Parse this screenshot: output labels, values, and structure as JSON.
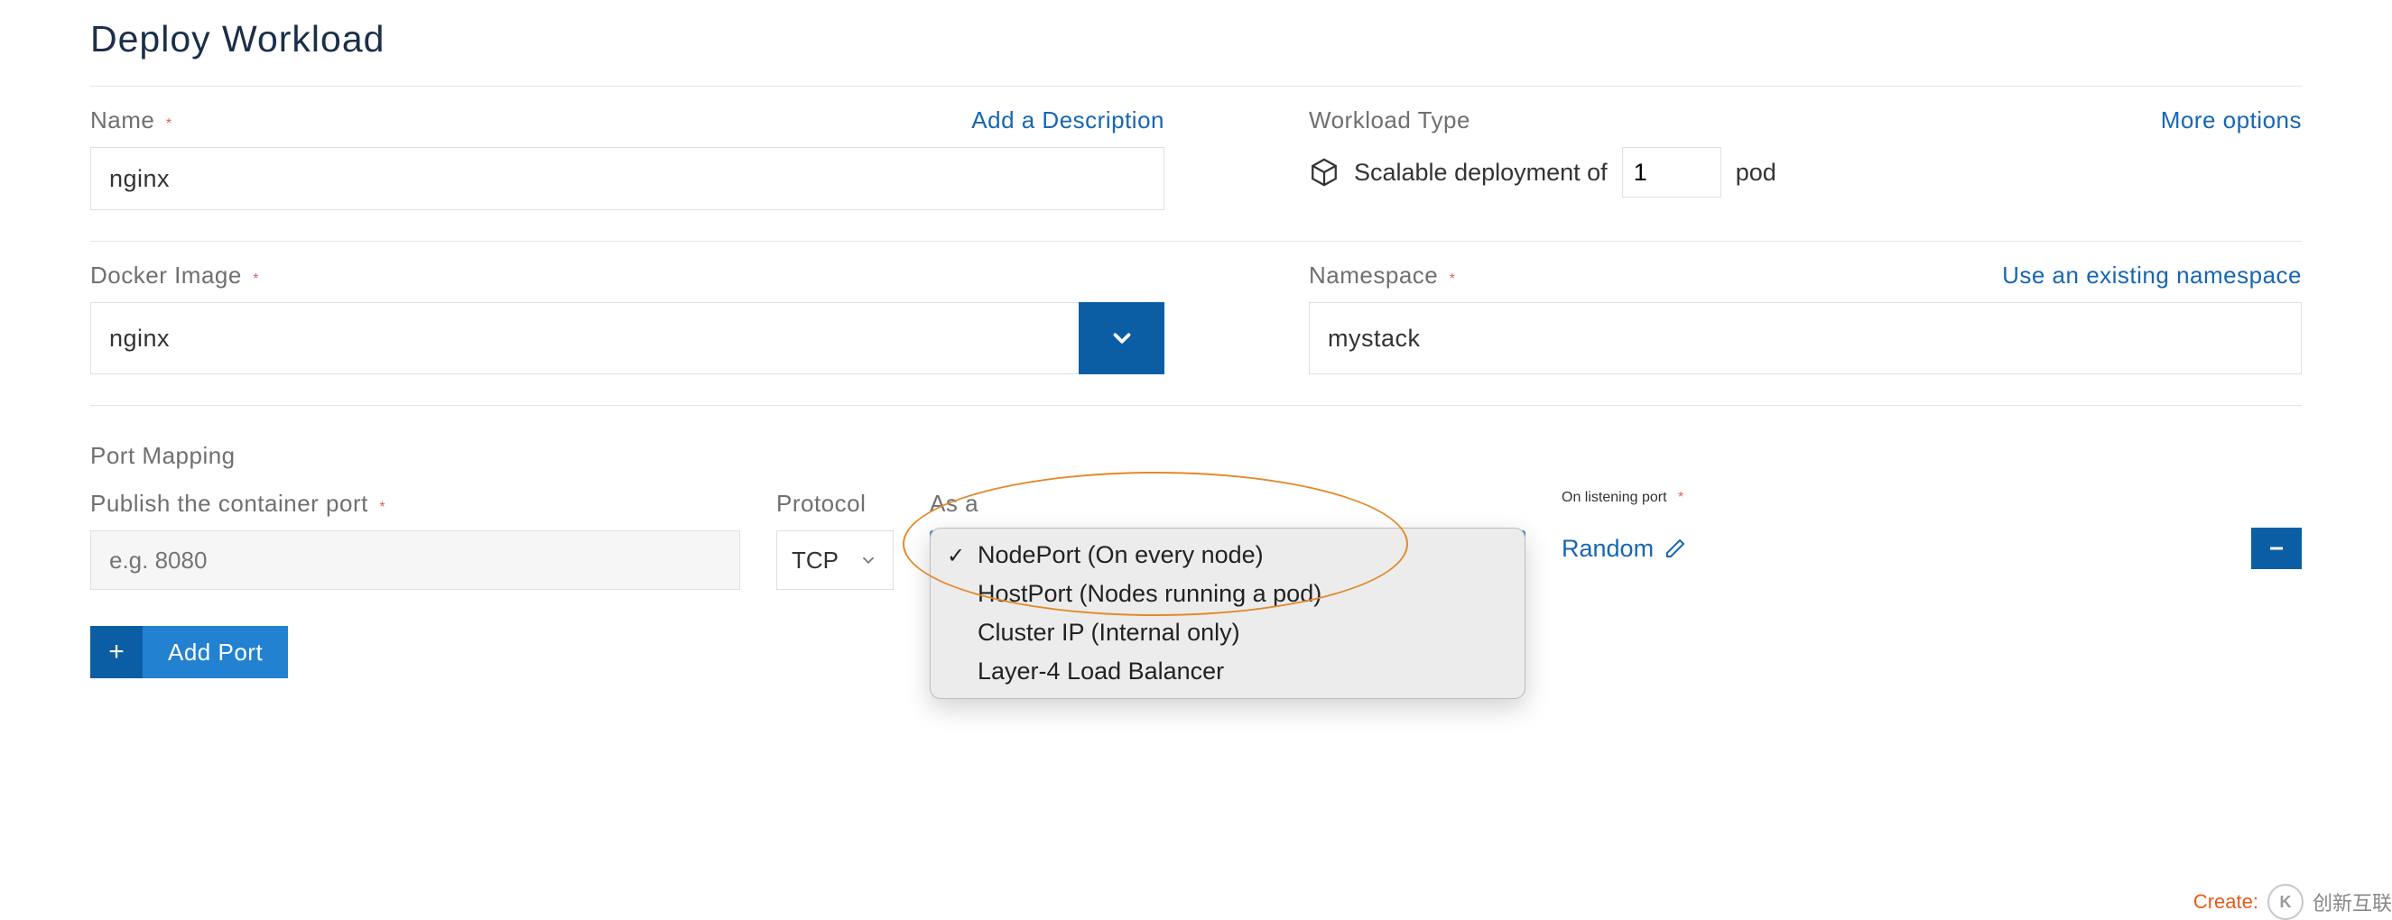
{
  "title": "Deploy Workload",
  "nameSection": {
    "label": "Name",
    "addDescription": "Add a Description",
    "value": "nginx"
  },
  "workloadType": {
    "label": "Workload Type",
    "moreOptions": "More options",
    "textPre": "Scalable deployment of",
    "podCount": "1",
    "textPost": "pod"
  },
  "dockerImage": {
    "label": "Docker Image",
    "value": "nginx"
  },
  "namespace": {
    "label": "Namespace",
    "useExisting": "Use an existing namespace",
    "value": "mystack"
  },
  "portMapping": {
    "sectionLabel": "Port Mapping",
    "publishLabel": "Publish the container port",
    "publishPlaceholder": "e.g. 8080",
    "protocolLabel": "Protocol",
    "protocolValue": "TCP",
    "asALabel": "As a",
    "dropdown": {
      "selectedIndex": 0,
      "options": [
        "NodePort (On every node)",
        "HostPort (Nodes running a pod)",
        "Cluster IP (Internal only)",
        "Layer-4 Load Balancer"
      ]
    },
    "listeningLabel": "On listening port",
    "listeningValue": "Random",
    "addPort": "Add Port"
  },
  "footer": {
    "create": "Create:",
    "brand": "创新互联"
  }
}
